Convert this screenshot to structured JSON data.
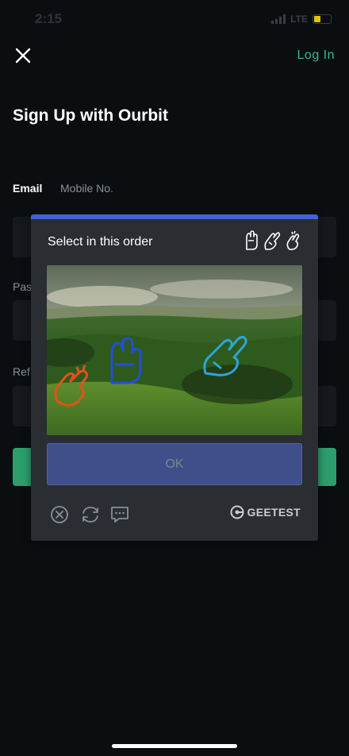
{
  "status_bar": {
    "time": "2:15",
    "network": "LTE"
  },
  "header": {
    "login_label": "Log In",
    "title": "Sign Up with Ourbit"
  },
  "tabs": {
    "email": "Email",
    "mobile": "Mobile No."
  },
  "form": {
    "password_label_partial": "Pas",
    "referral_label_partial": "Ref"
  },
  "captcha": {
    "prompt": "Select in this order",
    "hint_icons": [
      "three-fingers-hand-icon",
      "peace-sign-hand-icon",
      "finger-heart-hand-icon"
    ],
    "ok_label": "OK",
    "brand": "GEETEST",
    "accent_color": "#3f63d8"
  },
  "colors": {
    "brand_green": "#2ebd85",
    "background": "#0b0e11"
  }
}
